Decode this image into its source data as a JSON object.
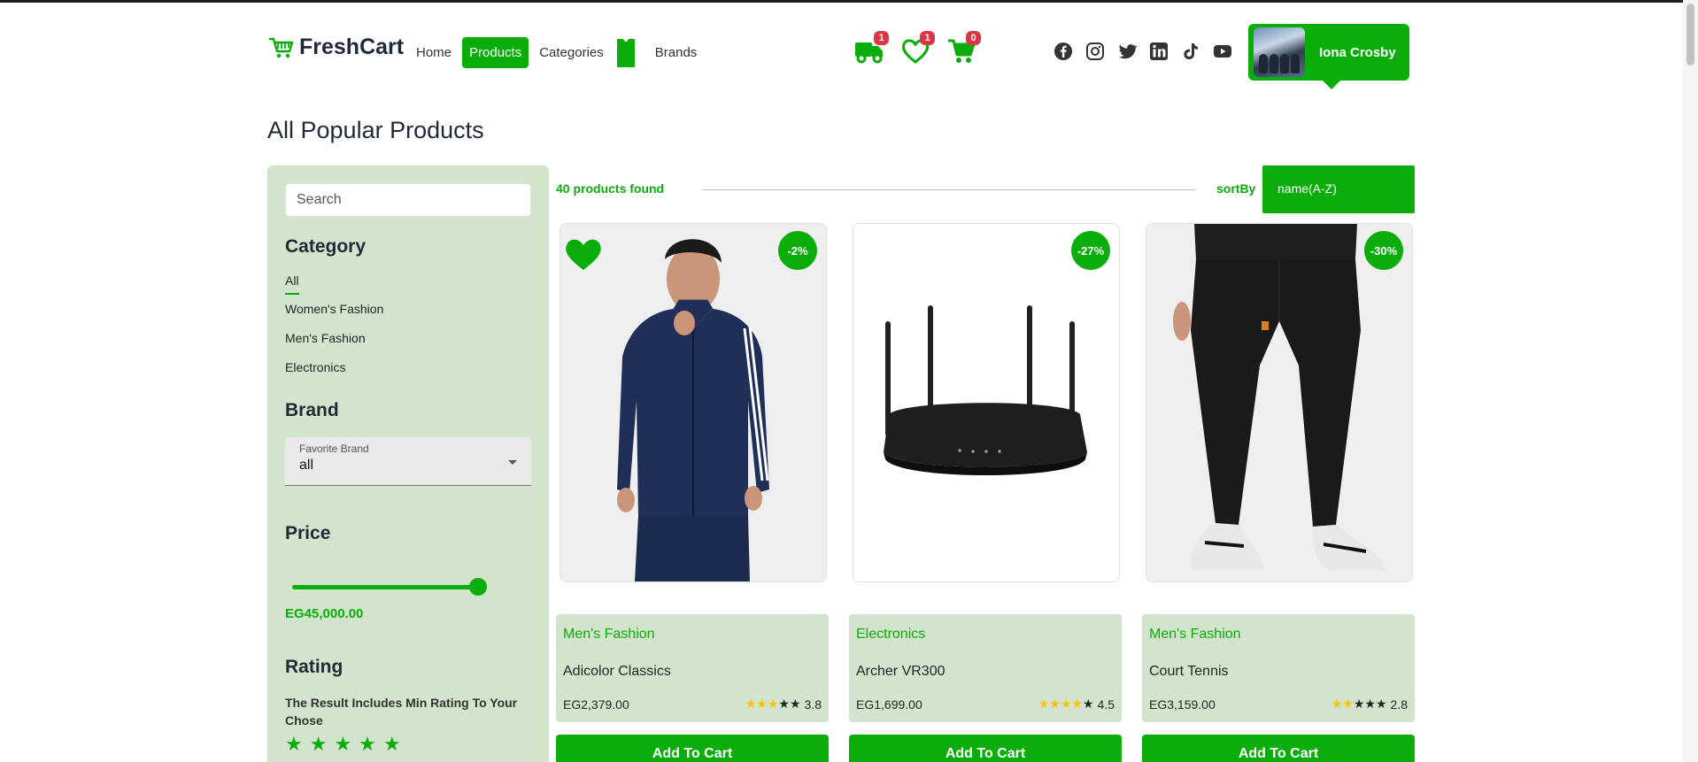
{
  "brand": {
    "name": "FreshCart"
  },
  "nav": {
    "links": [
      "Home",
      "Products",
      "Categories",
      "Brands"
    ],
    "active": "Products",
    "badges": {
      "orders": "1",
      "wishlist": "1",
      "cart": "0"
    }
  },
  "social": [
    "facebook-icon",
    "instagram-icon",
    "twitter-icon",
    "linkedin-icon",
    "tiktok-icon",
    "youtube-icon"
  ],
  "user": {
    "name": "Iona Crosby"
  },
  "page": {
    "title": "All Popular Products"
  },
  "filters": {
    "search_placeholder": "Search",
    "category_heading": "Category",
    "categories": [
      "All",
      "Women's Fashion",
      "Men's Fashion",
      "Electronics"
    ],
    "brand_heading": "Brand",
    "brand_select_label": "Favorite Brand",
    "brand_select_value": "all",
    "price_heading": "Price",
    "price_slider_fraction": 1.0,
    "price_value": "EG45,000.00",
    "rating_heading": "Rating",
    "rating_note": "The Result Includes Min Rating To Your Chose"
  },
  "results": {
    "count_text": "40 products found",
    "sort_label": "sortBy",
    "sort_value": "name(A-Z)"
  },
  "colors": {
    "accent": "#0aad0a",
    "panel": "#d3e4cd",
    "badge": "#dc3545",
    "star": "#ffc107"
  },
  "products": [
    {
      "discount": "-2%",
      "category": "Men's Fashion",
      "name": "Adicolor Classics",
      "price": "EG2,379.00",
      "rating": "3.8",
      "stars": 3,
      "wishlisted": true,
      "button": "Add To Cart"
    },
    {
      "discount": "-27%",
      "category": "Electronics",
      "name": "Archer VR300",
      "price": "EG1,699.00",
      "rating": "4.5",
      "stars": 4,
      "wishlisted": false,
      "button": "Add To Cart"
    },
    {
      "discount": "-30%",
      "category": "Men's Fashion",
      "name": "Court Tennis",
      "price": "EG3,159.00",
      "rating": "2.8",
      "stars": 2,
      "wishlisted": false,
      "button": "Add To Cart"
    }
  ]
}
